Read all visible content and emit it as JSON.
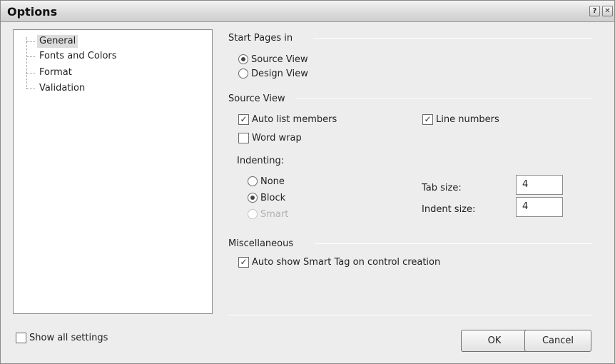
{
  "window": {
    "title": "Options",
    "help_glyph": "?",
    "close_glyph": "✕"
  },
  "tree": {
    "items": [
      {
        "label": "General",
        "selected": true
      },
      {
        "label": "Fonts and Colors"
      },
      {
        "label": "Format"
      },
      {
        "label": "Validation"
      }
    ]
  },
  "start_pages": {
    "heading": "Start Pages in",
    "source_view": {
      "label": "Source View",
      "checked": true
    },
    "design_view": {
      "label": "Design View",
      "checked": false
    }
  },
  "source_view": {
    "heading": "Source View",
    "auto_list_members": {
      "label": "Auto list members",
      "checked": true
    },
    "line_numbers": {
      "label": "Line numbers",
      "checked": true
    },
    "word_wrap": {
      "label": "Word wrap",
      "checked": false
    },
    "indenting": {
      "label": "Indenting:",
      "none": {
        "label": "None",
        "checked": false
      },
      "block": {
        "label": "Block",
        "checked": true
      },
      "smart": {
        "label": "Smart",
        "checked": false,
        "disabled": true
      }
    },
    "tab_size": {
      "label": "Tab size:",
      "value": "4"
    },
    "indent_size": {
      "label": "Indent size:",
      "value": "4"
    }
  },
  "misc": {
    "heading": "Miscellaneous",
    "auto_smart_tag": {
      "label": "Auto show Smart Tag on control creation",
      "checked": true
    }
  },
  "footer": {
    "show_all": {
      "label": "Show all settings",
      "checked": false
    },
    "ok_label": "OK",
    "cancel_label": "Cancel"
  },
  "check_glyph": "✓",
  "colors": {
    "background": "#ededed",
    "selection": "#dcdcdc",
    "disabled_text": "#b2b2b2"
  }
}
